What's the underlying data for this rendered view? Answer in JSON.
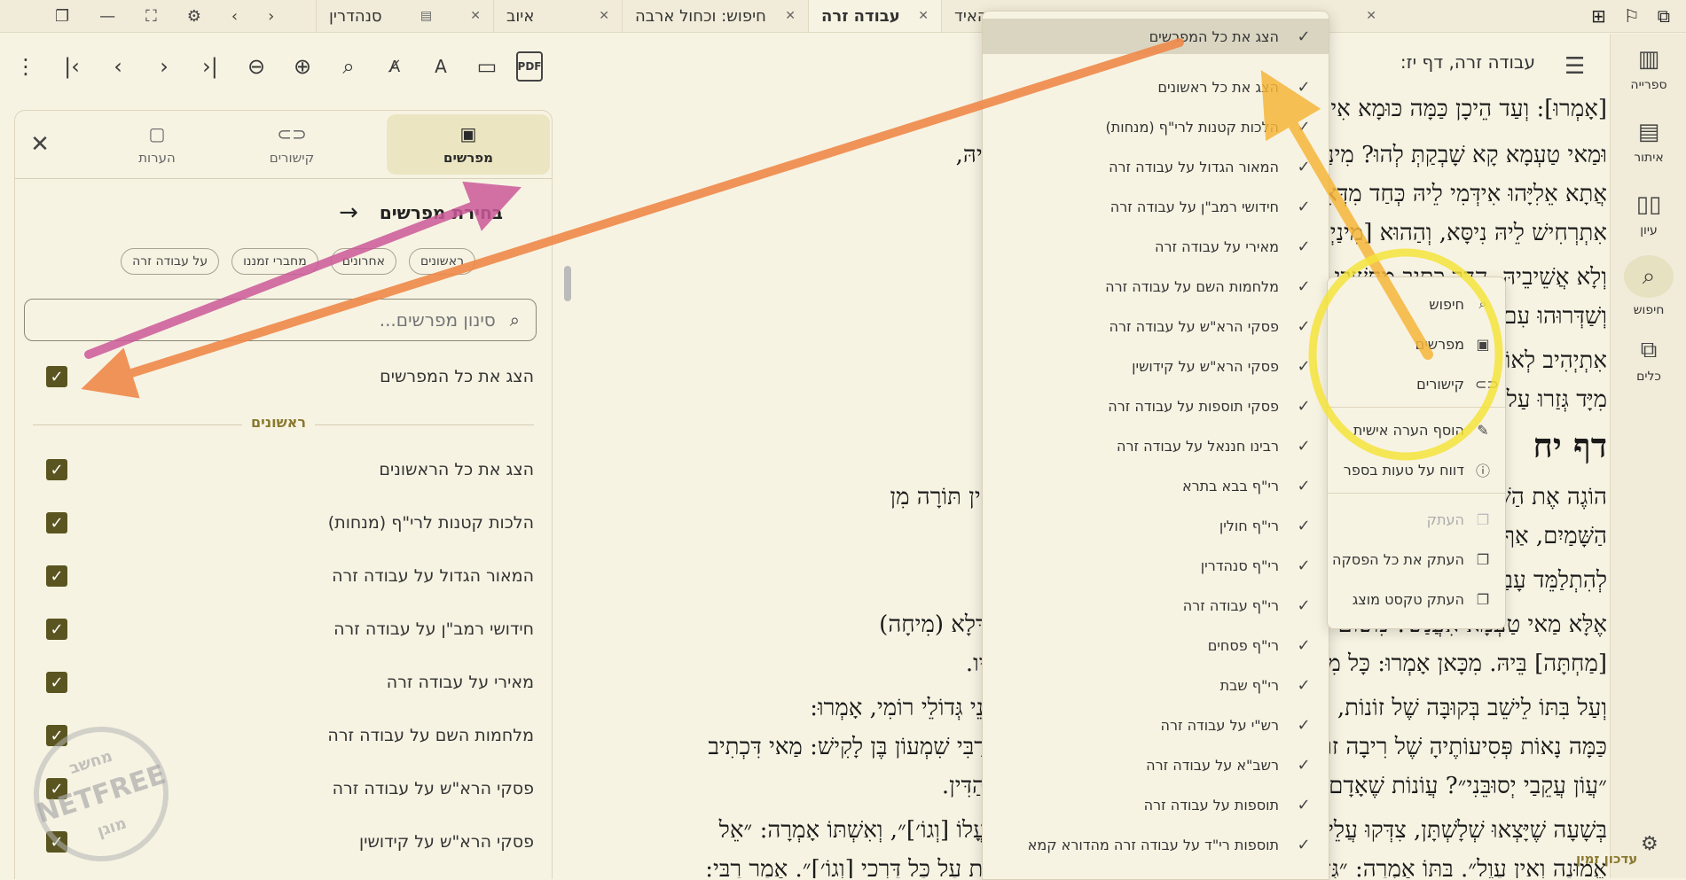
{
  "tabs": [
    {
      "label": "האיד",
      "active": false
    },
    {
      "label": "עבודה זרה",
      "active": true
    },
    {
      "label": "חיפוש: וכחול ארבה",
      "active": false
    },
    {
      "label": "איוב",
      "active": false
    },
    {
      "label": "סנהדרין",
      "active": false
    }
  ],
  "pdf_label": "PDF",
  "main": {
    "header": "עבודה זרה, דף יז:",
    "lines": [
      "[אָמְרוּ]: וְעַד הֵיכָן כַּמָּה כּוּמָא אִירְמַס חַד סָבָא.",
      "וּמַאי טַעְמָא קָא שָׁבְקַתְּ לְהוּ? מִינַּיְהוּ לְעוֹלָם. קָם חַד [מִינַיְיהוּ] לְאַסְהוּדֵי בֵּיהּ,",
      "אֲתָא אֵלִיָּהוּ אִידְּמִי לֵיהּ כְּחַד מִדְּאִתְרְחִישׁ לֵיהּ נִיסָּא בְּכוּלְּהוּ, בְּהָא נָמֵי",
      "אִתְרְחִישׁ לֵיהּ נִיסָּא, וְהַהוּא [מִינַיְיהוּ] שֶׁדַּר.",
      "וְלָא אֲשֵׁיבֵיהּ, הֲדַר כְּתִיב מְחַשְּׁבֵי דְמַלְכוּת לְשַׁדּוּרֵי לְבֵי קֵיסָר,",
      "וְשַׁדְּרוּהוּ עִם חַד פָּרְסִי, אֲזַל וְלָא אֲתָא.",
      "אִתְיְהִיב לְאוֹרַיְיתָא? אָמַר לְהוּ: ״כַּאֲשֶׁר צִוַּנִי ה׳ אֱלֹהָי״.",
      "מִיָּד גְּזַרוּ עַל בִּתּוֹ לֵישֵׁב בְּקוּבָּה שֶׁל זוֹנוֹת. עָלָיו לִשְׂרֵיפָה — שֶׁהָיָה",
      "דף יח",
      "הוֹגֶה אֶת הַשֵּׁם בְּאוֹתִיּוֹתָיו: אֵלּוּ שֶׁאֵין לָהֶם חֵלֶק לָעוֹלָם הַבָּא — הָאוֹמֵר אֵין תּוֹרָה מִן",
      "הַשָּׁמַיִם, אַף הַהוֹגֶה אֶת הַשֵּׁם בְּאוֹתִיּוֹתָיו!",
      "לְהִתְלַמֵּד עָבַד, לְהָבִין וּלְהוֹרוֹת.",
      "אֶלָּא מַאי טַעְמָא אִעֲנַשׁ? מִשּׁוּם דְּהֲוָה פָּרְסִיָּא [הֲוָה], וְעַל אִשְׁתּוֹ לַהֲרִיגָה דְּלָא (מִיחָה)",
      "[מַחְתָּה] בֵּיהּ. מִכָּאן אָמְרוּ: כָּל מִי שֶׁיֵּשׁ בְּיָדוֹ לִמְחוֹת וְאֵינוֹ מוֹחֶה נֶעֱנָשׁ עָלָיו.",
      "וְעַל בִּתּוֹ לֵישֵׁב בְּקוּבָּה שֶׁל זוֹנוֹת, דְּאָמַר: פַּעַם אַחַת הָיְתָה בִּתּוֹ מְהַלֶּכֶת לִפְנֵי גְּדוֹלֵי רוֹמִי, אָמְרוּ:",
      "כַּמָּה נָאוֹת פְּסִיעוֹתֶיהָ שֶׁל רִיבָה זוֹ! מִיָּד דִּקְדְּקָה בִּפְסִיעוֹתֶיהָ. וְהַיְינוּ דְּאָמַר רַבִּי שִׁמְעוֹן בֶּן לָקִישׁ: מַאי דִּכְתִיב",
      "״עֲוֹן עֲקֵבַי יְסוּבֵּנִי״? עֲוֹנוֹת שֶׁאָדָם דָּשׁ בַּעֲקֵבָיו בָּעוֹלָם הַזֶּה מְסוּבִּין לוֹ לְיוֹם הַדִּין.",
      "בְּשָׁעָה שֶׁיָּצְאוּ שְׁלָשְׁתָּן, צִדְּקוּ עֲלֵיהֶם אֶת הַדִּין. הוּא אָמַר: ״הַצּוּר תָּמִים פָּעֳלוֹ [וְגוֹ׳]״, וְאִשְׁתּוֹ אָמְרָה: ״אֵל",
      "אֱמוּנָה וְאֵין עָוֶל״. בִּתּוֹ אָמְרָה: ״גְּדֹל הָעֵצָה וְרַב הָעֲלִילִיָּה אֲשֶׁר עֵינֶיךָ פְּקֻחוֹת עַל כָּל דַּרְכֵי [וְגוֹ׳]״. אָמַר רַבִּי:"
    ]
  },
  "panel": {
    "tabs": [
      {
        "label": "מפרשים",
        "icon": "book-icon"
      },
      {
        "label": "קישורים",
        "icon": "link-icon"
      },
      {
        "label": "הערות",
        "icon": "note-icon"
      }
    ],
    "title": "בחירת מפרשים",
    "chips": [
      "ראשונים",
      "אחרונים",
      "מחברי זמננו",
      "על עבודה זרה"
    ],
    "filter_placeholder": "סינון מפרשים...",
    "show_all": "הצג את כל המפרשים",
    "section_title": "ראשונים",
    "items": [
      "הצג את כל הראשונים",
      "הלכות קטנות לרי\"ף (מנחות)",
      "המאור הגדול על עבודה זרה",
      "חידושי רמב\"ן על עבודה זרה",
      "מאירי על עבודה זרה",
      "מלחמות השם על עבודה זרה",
      "פסקי הרא\"ש על עבודה זרה",
      "פסקי הרא\"ש על קידושין"
    ]
  },
  "commentators_menu": [
    "הצג את כל המפרשים",
    "הצג את כל ראשונים",
    "הלכות קטנות לרי\"ף (מנחות)",
    "המאור הגדול על עבודה זרה",
    "חידושי רמב\"ן על עבודה זרה",
    "מאירי על עבודה זרה",
    "מלחמות השם על עבודה זרה",
    "פסקי הרא\"ש על עבודה זרה",
    "פסקי הרא\"ש על קידושין",
    "פסקי תוספות על עבודה זרה",
    "רבינו חננאל על עבודה זרה",
    "רי\"ף בבא בתרא",
    "רי\"ף חולין",
    "רי\"ף סנהדרין",
    "רי\"ף עבודה זרה",
    "רי\"ף פסחים",
    "רי\"ף שבת",
    "רש\"י על עבודה זרה",
    "רשב\"א על עבודה זרה",
    "תוספות על עבודה זרה",
    "תוספות רי\"ד על עבודה זרה מהדורא קמא"
  ],
  "context_menu": [
    {
      "label": "חיפוש",
      "icon": "search-icon",
      "disabled": false
    },
    {
      "label": "מפרשים",
      "icon": "book-icon",
      "disabled": false
    },
    {
      "label": "קישורים",
      "icon": "link-icon",
      "disabled": false
    },
    {
      "label": "הוסף הערה אישית",
      "icon": "note-add-icon",
      "disabled": false
    },
    {
      "label": "דווח על טעות בספר",
      "icon": "alert-icon",
      "disabled": false
    },
    {
      "label": "העתק",
      "icon": "copy-icon",
      "disabled": true
    },
    {
      "label": "העתק את כל הפסקה",
      "icon": "copy-icon",
      "disabled": false
    },
    {
      "label": "העתק טקסט מוצג",
      "icon": "copy-icon",
      "disabled": false
    }
  ],
  "nav": [
    {
      "label": "ספרייה",
      "icon": "library-icon"
    },
    {
      "label": "איתור",
      "icon": "locate-icon"
    },
    {
      "label": "עיון",
      "icon": "read-icon"
    },
    {
      "label": "חיפוש",
      "icon": "search-icon"
    },
    {
      "label": "כלים",
      "icon": "tools-icon"
    }
  ],
  "update_label": "עדכון זמין",
  "watermark": {
    "top": "מחשב",
    "middle": "NETFREE",
    "bottom": "מוגן"
  },
  "colors": {
    "background": "#f7f3e3",
    "accent_olive": "#5a5520",
    "selected_tab": "#ebe6c1",
    "arrow_orange": "#f0894a",
    "arrow_pink": "#cc5a9a",
    "arrow_yellow": "#f6b73c",
    "highlight_circle": "#f4e33c"
  }
}
